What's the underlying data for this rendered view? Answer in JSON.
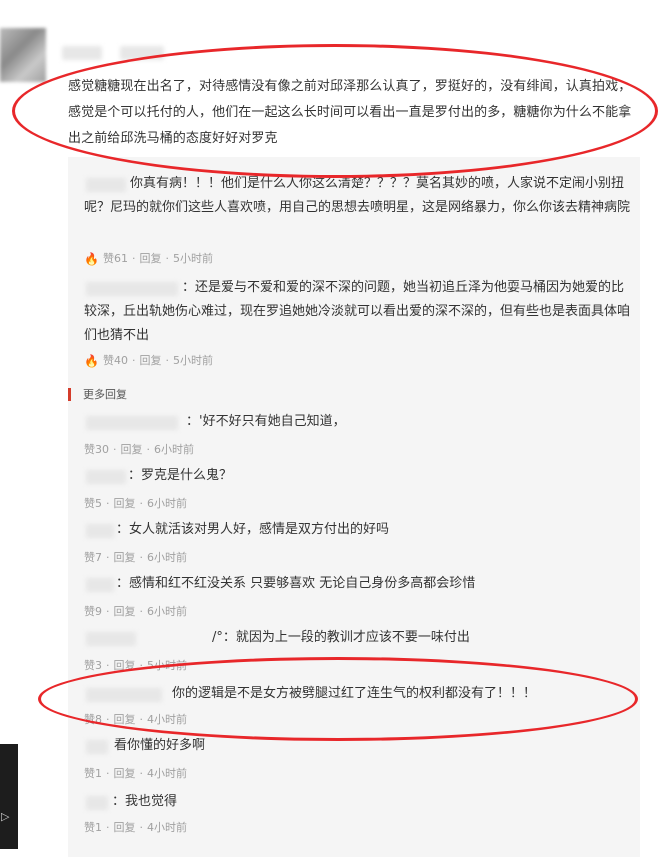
{
  "main_comment": {
    "text": "感觉糖糖现在出名了，对待感情没有像之前对邱泽那么认真了，罗挺好的，没有绯闻，认真拍戏，感觉是个可以托付的人，他们在一起这么长时间可以看出一直是罗付出的多，糖糖你为什么不能拿出之前给邱洗马桶的态度好好对罗克"
  },
  "hot_replies": [
    {
      "text": "你真有病！！！他们是什么人你这么清楚？？？？莫名其妙的喷，人家说不定闹小别扭呢？尼玛的就你们这些人喜欢喷，用自己的思想去喷明星，这是网络暴力，你么你该去精神病院",
      "likes": "赞61",
      "reply": "回复",
      "time": "5小时前"
    },
    {
      "text": "：还是爱与不爱和爱的深不深的问题，她当初追丘泽为他耍马桶因为她爱的比较深，丘出轨她伤心难过，现在罗追她她冷淡就可以看出爱的深不深的，但有些也是表面具体咱们也猜不出",
      "likes": "赞40",
      "reply": "回复",
      "time": "5小时前"
    }
  ],
  "more_replies_label": "更多回复",
  "more_replies": [
    {
      "text": "：'好不好只有她自己知道，",
      "likes": "赞30",
      "reply": "回复",
      "time": "6小时前"
    },
    {
      "text": "：罗克是什么鬼？",
      "likes": "赞5",
      "reply": "回复",
      "time": "6小时前"
    },
    {
      "text": "：女人就活该对男人好，感情是双方付出的好吗",
      "likes": "赞7",
      "reply": "回复",
      "time": "6小时前"
    },
    {
      "text": "：感情和红不红没关系 只要够喜欢 无论自己身份多高都会珍惜",
      "likes": "赞9",
      "reply": "回复",
      "time": "6小时前"
    },
    {
      "text": "/°：就因为上一段的教训才应该不要一味付出",
      "likes": "赞3",
      "reply": "回复",
      "time": "5小时前"
    },
    {
      "text": "你的逻辑是不是女方被劈腿过红了连生气的权利都没有了！！！",
      "likes": "赞8",
      "reply": "回复",
      "time": "4小时前"
    },
    {
      "text": "看你懂的好多啊",
      "likes": "赞1",
      "reply": "回复",
      "time": "4小时前"
    },
    {
      "text": "：我也觉得",
      "likes": "赞1",
      "reply": "回复",
      "time": "4小时前"
    }
  ],
  "colors": {
    "highlight_oval": "#e8272a",
    "fire": "#d9481c",
    "meta_text": "#a0a0a0"
  },
  "icons": {
    "fire": "fire-icon",
    "video": "video-icon"
  }
}
